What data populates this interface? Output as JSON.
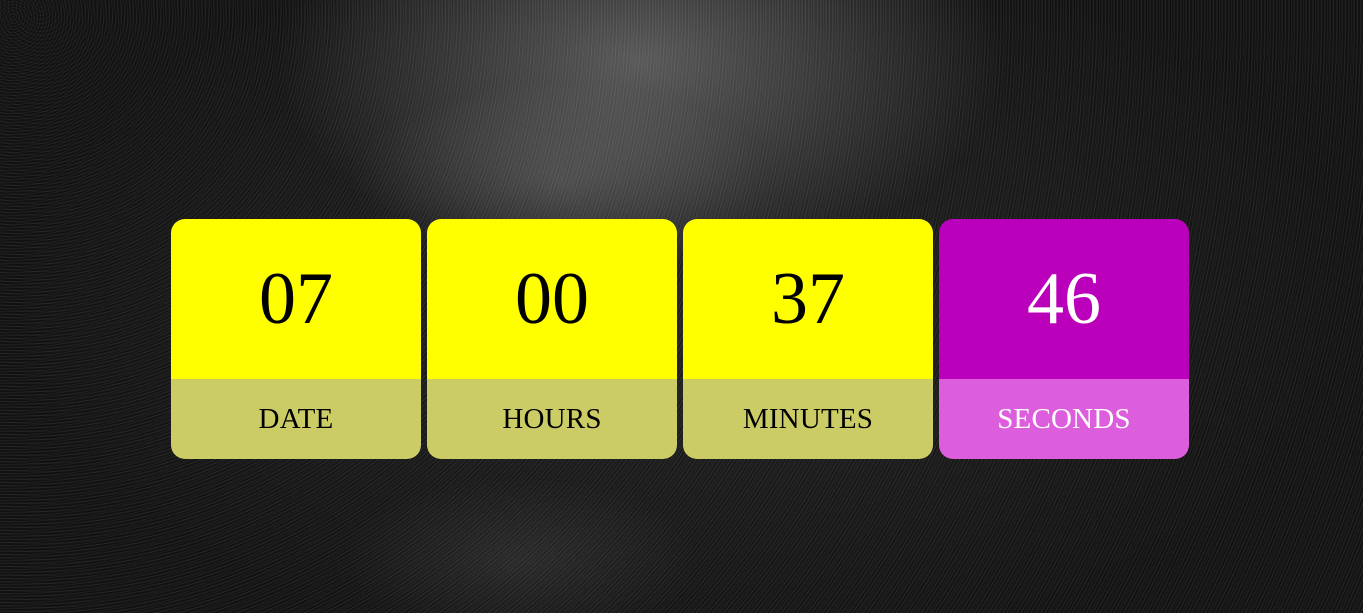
{
  "countdown": {
    "units": [
      {
        "value": "07",
        "label": "DATE"
      },
      {
        "value": "00",
        "label": "HOURS"
      },
      {
        "value": "37",
        "label": "MINUTES"
      },
      {
        "value": "46",
        "label": "SECONDS"
      }
    ]
  },
  "colors": {
    "tile_value_bg": "#ffff00",
    "tile_label_bg": "#cccc66",
    "active_value_bg": "#bb00bb",
    "active_label_bg": "#dd5edd",
    "page_bg": "#121212"
  }
}
